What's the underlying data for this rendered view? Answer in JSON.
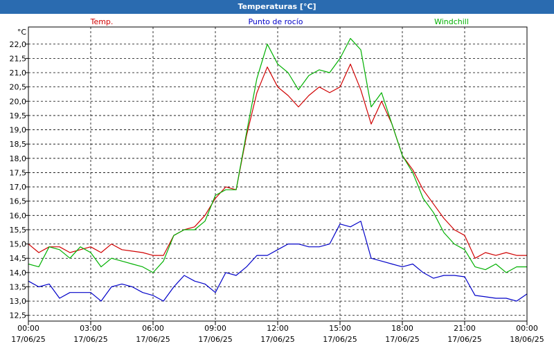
{
  "title": "Temperaturas [°C]",
  "chart_data": {
    "type": "line",
    "title": "Temperaturas [°C]",
    "ylabel": "°C",
    "ylim": [
      12.3,
      22.6
    ],
    "xlim": [
      0,
      24
    ],
    "yticks": [
      12.5,
      13.0,
      13.5,
      14.0,
      14.5,
      15.0,
      15.5,
      16.0,
      16.5,
      17.0,
      17.5,
      18.0,
      18.5,
      19.0,
      19.5,
      20.0,
      20.5,
      21.0,
      21.5,
      22.0
    ],
    "ytick_labels": [
      "12,5",
      "13,0",
      "13,5",
      "14,0",
      "14,5",
      "15,0",
      "15,5",
      "16,0",
      "16,5",
      "17,0",
      "17,5",
      "18,0",
      "18,5",
      "19,0",
      "19,5",
      "20,0",
      "20,5",
      "21,0",
      "21,5",
      "22,0"
    ],
    "xticks": [
      {
        "x": 0,
        "time": "00:00",
        "date": "17/06/25"
      },
      {
        "x": 3,
        "time": "03:00",
        "date": "17/06/25"
      },
      {
        "x": 6,
        "time": "06:00",
        "date": "17/06/25"
      },
      {
        "x": 9,
        "time": "09:00",
        "date": "17/06/25"
      },
      {
        "x": 12,
        "time": "12:00",
        "date": "17/06/25"
      },
      {
        "x": 15,
        "time": "15:00",
        "date": "17/06/25"
      },
      {
        "x": 18,
        "time": "18:00",
        "date": "17/06/25"
      },
      {
        "x": 21,
        "time": "21:00",
        "date": "17/06/25"
      },
      {
        "x": 24,
        "time": "00:00",
        "date": "18/06/25"
      }
    ],
    "grid": true,
    "series": [
      {
        "name": "Temp.",
        "color": "#d00000",
        "x": [
          0,
          0.5,
          1,
          1.5,
          2,
          2.5,
          3,
          3.5,
          4,
          4.5,
          5,
          5.5,
          6,
          6.5,
          7,
          7.5,
          8,
          8.5,
          9,
          9.5,
          10,
          10.5,
          11,
          11.5,
          12,
          12.5,
          13,
          13.5,
          14,
          14.5,
          15,
          15.5,
          16,
          16.5,
          17,
          17.5,
          18,
          18.5,
          19,
          19.5,
          20,
          20.5,
          21,
          21.5,
          22,
          22.5,
          23,
          23.5,
          24
        ],
        "values": [
          15.0,
          14.7,
          14.9,
          14.9,
          14.7,
          14.8,
          14.9,
          14.7,
          15.0,
          14.8,
          14.75,
          14.7,
          14.6,
          14.6,
          15.3,
          15.5,
          15.6,
          16.0,
          16.6,
          17.0,
          16.9,
          18.8,
          20.3,
          21.2,
          20.5,
          20.2,
          19.8,
          20.2,
          20.5,
          20.3,
          20.5,
          21.3,
          20.4,
          19.2,
          20.0,
          19.2,
          18.1,
          17.6,
          16.9,
          16.4,
          15.9,
          15.5,
          15.3,
          14.5,
          14.7,
          14.6,
          14.7,
          14.6,
          14.6
        ]
      },
      {
        "name": "Punto de rocío",
        "color": "#0000c8",
        "x": [
          0,
          0.5,
          1,
          1.5,
          2,
          2.5,
          3,
          3.5,
          4,
          4.5,
          5,
          5.5,
          6,
          6.5,
          7,
          7.5,
          8,
          8.5,
          9,
          9.5,
          10,
          10.5,
          11,
          11.5,
          12,
          12.5,
          13,
          13.5,
          14,
          14.5,
          15,
          15.5,
          16,
          16.5,
          17,
          17.5,
          18,
          18.5,
          19,
          19.5,
          20,
          20.5,
          21,
          21.5,
          22,
          22.5,
          23,
          23.5,
          24
        ],
        "values": [
          13.7,
          13.5,
          13.6,
          13.1,
          13.3,
          13.3,
          13.3,
          13.0,
          13.5,
          13.6,
          13.5,
          13.3,
          13.2,
          13.0,
          13.5,
          13.9,
          13.7,
          13.6,
          13.3,
          14.0,
          13.9,
          14.2,
          14.6,
          14.6,
          14.8,
          15.0,
          15.0,
          14.9,
          14.9,
          15.0,
          15.7,
          15.6,
          15.8,
          14.5,
          14.4,
          14.3,
          14.2,
          14.3,
          14.0,
          13.8,
          13.9,
          13.9,
          13.85,
          13.2,
          13.15,
          13.1,
          13.1,
          13.0,
          13.25
        ]
      },
      {
        "name": "Windchill",
        "color": "#00b000",
        "x": [
          0,
          0.5,
          1,
          1.5,
          2,
          2.5,
          3,
          3.5,
          4,
          4.5,
          5,
          5.5,
          6,
          6.5,
          7,
          7.5,
          8,
          8.5,
          9,
          9.5,
          10,
          10.5,
          11,
          11.5,
          12,
          12.5,
          13,
          13.5,
          14,
          14.5,
          15,
          15.5,
          16,
          16.5,
          17,
          17.5,
          18,
          18.5,
          19,
          19.5,
          20,
          20.5,
          21,
          21.5,
          22,
          22.5,
          23,
          23.5,
          24
        ],
        "values": [
          14.3,
          14.2,
          14.9,
          14.8,
          14.5,
          14.9,
          14.7,
          14.2,
          14.5,
          14.4,
          14.3,
          14.2,
          14.0,
          14.4,
          15.3,
          15.5,
          15.5,
          15.8,
          16.7,
          16.9,
          16.9,
          18.9,
          20.8,
          22.0,
          21.3,
          21.0,
          20.4,
          20.9,
          21.1,
          21.0,
          21.5,
          22.2,
          21.8,
          19.8,
          20.3,
          19.2,
          18.1,
          17.5,
          16.6,
          16.1,
          15.4,
          15.0,
          14.8,
          14.2,
          14.1,
          14.3,
          14.0,
          14.2,
          14.2
        ]
      }
    ]
  }
}
